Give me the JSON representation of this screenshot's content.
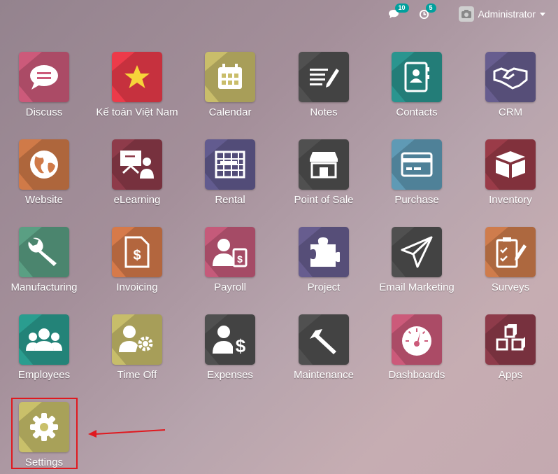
{
  "topbar": {
    "chat_count": "10",
    "activity_count": "5",
    "user_name": "Administrator"
  },
  "apps": [
    {
      "label": "Discuss",
      "color": "#cc5a7a",
      "icon": "chat-icon"
    },
    {
      "label": "Kế toán Việt Nam",
      "color": "#ec3b4a",
      "icon": "star-icon"
    },
    {
      "label": "Calendar",
      "color": "#c9bd6a",
      "icon": "calendar-icon"
    },
    {
      "label": "Notes",
      "color": "#505050",
      "icon": "notes-icon"
    },
    {
      "label": "Contacts",
      "color": "#2a958f",
      "icon": "contacts-icon"
    },
    {
      "label": "CRM",
      "color": "#675d8f",
      "icon": "handshake-icon"
    },
    {
      "label": "Website",
      "color": "#d07a48",
      "icon": "globe-icon"
    },
    {
      "label": "eLearning",
      "color": "#8e3b4a",
      "icon": "presentation-icon"
    },
    {
      "label": "Rental",
      "color": "#625b8f",
      "icon": "rental-icon"
    },
    {
      "label": "Point of Sale",
      "color": "#505050",
      "icon": "shop-icon"
    },
    {
      "label": "Purchase",
      "color": "#5f9ab5",
      "icon": "credit-card-icon"
    },
    {
      "label": "Inventory",
      "color": "#9a3b48",
      "icon": "box-icon"
    },
    {
      "label": "Manufacturing",
      "color": "#5a9f83",
      "icon": "wrench-icon"
    },
    {
      "label": "Invoicing",
      "color": "#d67a4a",
      "icon": "invoice-icon"
    },
    {
      "label": "Payroll",
      "color": "#c55a7a",
      "icon": "payroll-icon"
    },
    {
      "label": "Project",
      "color": "#675d8f",
      "icon": "puzzle-icon"
    },
    {
      "label": "Email Marketing",
      "color": "#505050",
      "icon": "paper-plane-icon"
    },
    {
      "label": "Surveys",
      "color": "#cf7c4c",
      "icon": "survey-icon"
    },
    {
      "label": "Employees",
      "color": "#2a9d8f",
      "icon": "users-icon"
    },
    {
      "label": "Time Off",
      "color": "#c7bd6a",
      "icon": "time-off-icon"
    },
    {
      "label": "Expenses",
      "color": "#505050",
      "icon": "expenses-icon"
    },
    {
      "label": "Maintenance",
      "color": "#505050",
      "icon": "hammer-icon"
    },
    {
      "label": "Dashboards",
      "color": "#cc5a7a",
      "icon": "gauge-icon"
    },
    {
      "label": "Apps",
      "color": "#8e3b4a",
      "icon": "cubes-icon"
    },
    {
      "label": "Settings",
      "color": "#c9c06a",
      "icon": "gear-icon"
    }
  ]
}
